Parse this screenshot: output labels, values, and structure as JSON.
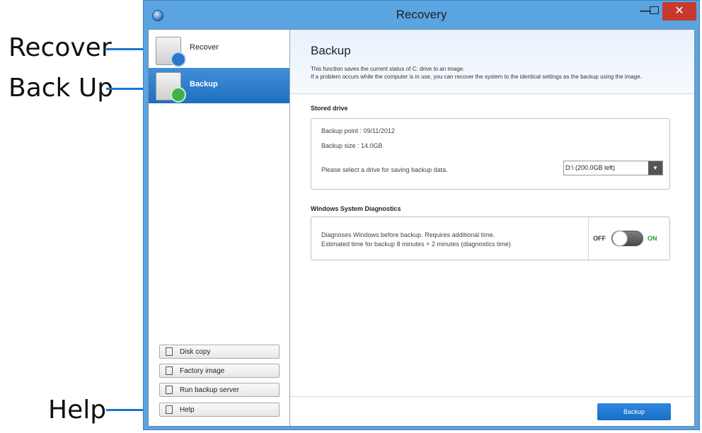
{
  "callouts": {
    "recover": "Recover",
    "backup": "Back Up",
    "help": "Help"
  },
  "window": {
    "title": "Recovery",
    "controls": {
      "minimize": "—",
      "close": "✕"
    }
  },
  "sidebar": {
    "items": [
      {
        "label": "Recover",
        "icon": "recover-icon",
        "selected": false
      },
      {
        "label": "Backup",
        "icon": "backup-icon",
        "selected": true
      }
    ],
    "buttons": [
      {
        "label": "Disk copy",
        "icon": "disk-copy-icon"
      },
      {
        "label": "Factory image",
        "icon": "factory-image-icon"
      },
      {
        "label": "Run backup server",
        "icon": "backup-server-icon"
      },
      {
        "label": "Help",
        "icon": "help-icon"
      }
    ]
  },
  "main": {
    "title": "Backup",
    "description": [
      "This function saves the current status of C: drive to an image.",
      "If a problem occurs while the computer is in use, you can recover the system to the identical settings as the backup using the image."
    ],
    "stored_drive": {
      "section_title": "Stored drive",
      "backup_point": "Backup point : 09/11/2012",
      "backup_size": "Backup size : 14.0GB",
      "select_prompt": "Please select a drive for saving backup data.",
      "drive_selected": "D:\\ (200.0GB left)"
    },
    "diagnostics": {
      "section_title": "Windows System Diagnostics",
      "line1": "Diagnoses Windows before backup. Requires additional time.",
      "line2": "Estimated time for backup 8 minutes + 2 minutes (diagnostics time)",
      "off_label": "OFF",
      "on_label": "ON",
      "enabled": false
    },
    "backup_button": "Backup"
  },
  "colors": {
    "accent": "#1976d2",
    "titlebar": "#5aa4e2",
    "close_button": "#c7392c",
    "selected_nav": "#2f7fcf",
    "on_green": "#1ea03a"
  }
}
